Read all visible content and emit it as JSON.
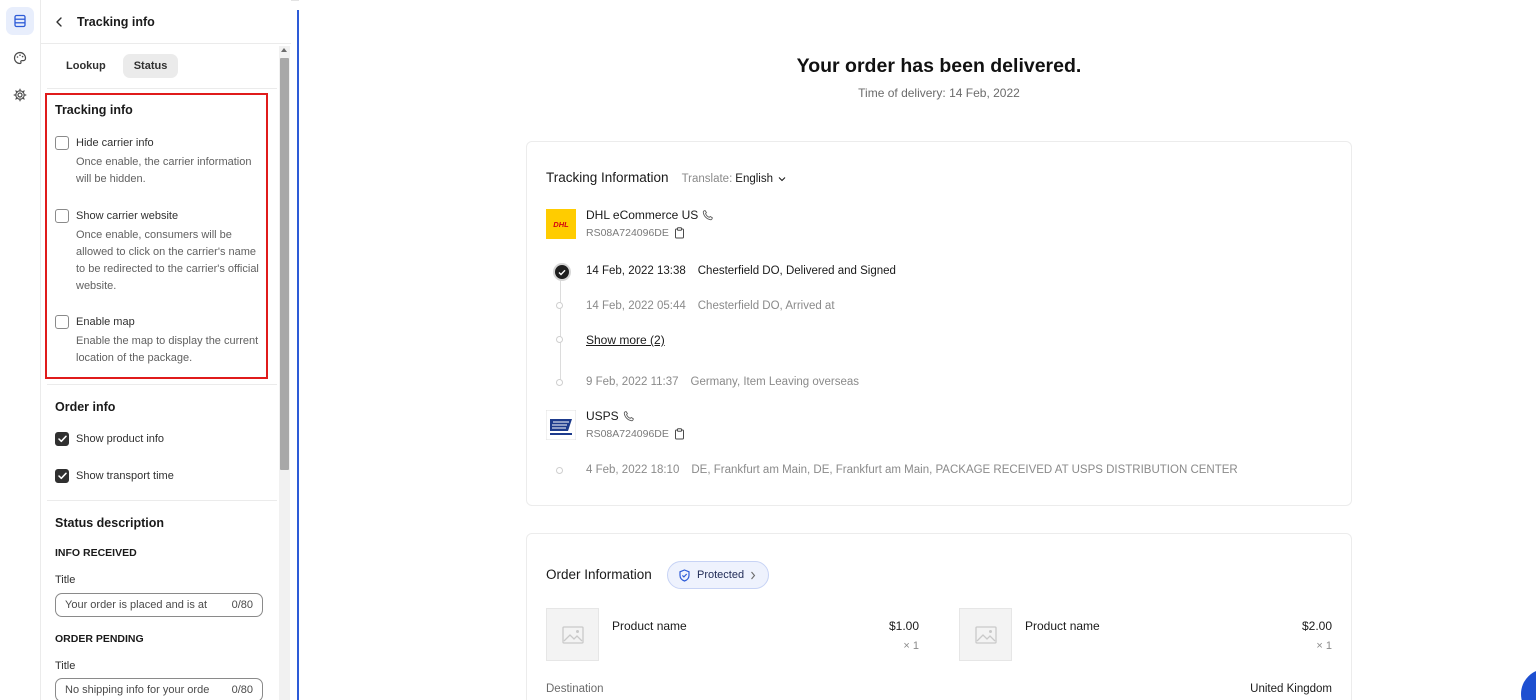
{
  "panel": {
    "title": "Tracking info",
    "tabs": [
      "Lookup",
      "Status"
    ],
    "active_tab": "Status"
  },
  "tracking_section": {
    "title": "Tracking info",
    "options": [
      {
        "label": "Hide carrier info",
        "help": "Once enable, the carrier information will be hidden.",
        "checked": false
      },
      {
        "label": "Show carrier website",
        "help": "Once enable, consumers will be allowed to click on the carrier's name to be redirected to the carrier's official website.",
        "checked": false
      },
      {
        "label": "Enable map",
        "help": "Enable the map to display the current location of the package.",
        "checked": false
      }
    ]
  },
  "order_section": {
    "title": "Order info",
    "options": [
      {
        "label": "Show product info",
        "checked": true
      },
      {
        "label": "Show transport time",
        "checked": true
      }
    ]
  },
  "status_section": {
    "title": "Status description",
    "groups": [
      {
        "name": "INFO RECEIVED",
        "field_label": "Title",
        "value": "Your order is placed and is at",
        "counter": "0/80"
      },
      {
        "name": "ORDER PENDING",
        "field_label": "Title",
        "value": "No shipping info for your orde",
        "counter": "0/80"
      }
    ]
  },
  "preview": {
    "headline": "Your order has been delivered.",
    "subline": "Time of delivery: 14 Feb, 2022",
    "tracking": {
      "heading": "Tracking Information",
      "translate_label": "Translate:",
      "language": "English",
      "carriers": [
        {
          "name": "DHL eCommerce US",
          "number": "RS08A724096DE",
          "logo_text": "DHL"
        },
        {
          "name": "USPS",
          "number": "RS08A724096DE"
        }
      ],
      "events": [
        {
          "time": "14 Feb, 2022 13:38",
          "text": "Chesterfield DO, Delivered and Signed"
        },
        {
          "time": "14 Feb, 2022 05:44",
          "text": "Chesterfield DO, Arrived at"
        },
        {
          "time": "9 Feb, 2022 11:37",
          "text": "Germany, Item Leaving overseas"
        },
        {
          "time": "4 Feb, 2022 18:10",
          "text": "DE, Frankfurt am Main, DE, Frankfurt am Main, PACKAGE RECEIVED AT USPS DISTRIBUTION CENTER"
        }
      ],
      "show_more": "Show more (2)"
    },
    "order": {
      "heading": "Order Information",
      "badge": "Protected",
      "products": [
        {
          "name": "Product name",
          "price": "$1.00",
          "qty": "× 1"
        },
        {
          "name": "Product name",
          "price": "$2.00",
          "qty": "× 1"
        }
      ],
      "destination_label": "Destination",
      "destination_value": "United Kingdom"
    }
  },
  "colors": {
    "accent": "#2d5bd7",
    "highlight": "#e01b1b",
    "dhl_yellow": "#ffcc00",
    "dhl_red": "#d40511"
  }
}
